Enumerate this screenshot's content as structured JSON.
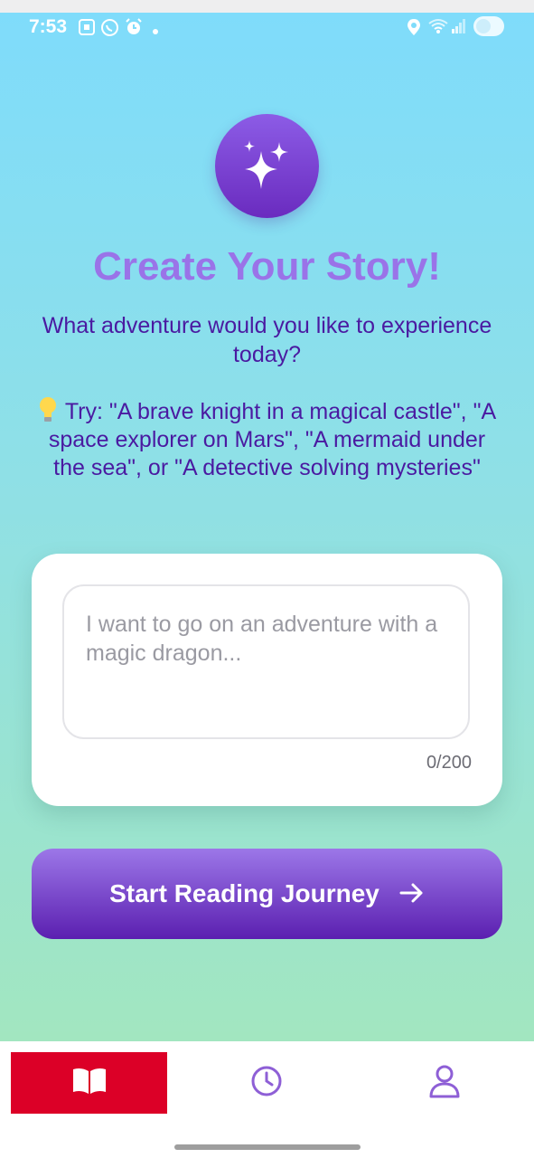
{
  "status_bar": {
    "time": "7:53",
    "left_icons": [
      "screenshot-icon",
      "whatsapp-icon",
      "alarm-icon",
      "dot-icon"
    ],
    "right_icons": [
      "location-icon",
      "wifi-icon",
      "signal-icon",
      "battery-icon"
    ]
  },
  "hero": {
    "icon": "sparkles-icon",
    "title": "Create Your Story!",
    "subtitle": "What adventure would you like to experience today?",
    "tip": "Try: \"A brave knight in a magical castle\", \"A space explorer on Mars\", \"A mermaid under the sea\", or \"A detective solving mysteries\""
  },
  "story_input": {
    "value": "",
    "placeholder": "I want to go on an adventure with a magic dragon...",
    "char_count": "0/200"
  },
  "start_button": {
    "label": "Start Reading Journey",
    "icon": "arrow-right-icon"
  },
  "bottom_nav": {
    "items": [
      {
        "name": "stories",
        "icon": "book-icon",
        "active": true
      },
      {
        "name": "history",
        "icon": "clock-icon",
        "active": false
      },
      {
        "name": "profile",
        "icon": "user-icon",
        "active": false
      }
    ]
  },
  "colors": {
    "accent_purple": "#6a2bbf",
    "title_purple": "#9a73e8",
    "text_purple": "#4a1aa1",
    "nav_active_red": "#dc0027"
  }
}
